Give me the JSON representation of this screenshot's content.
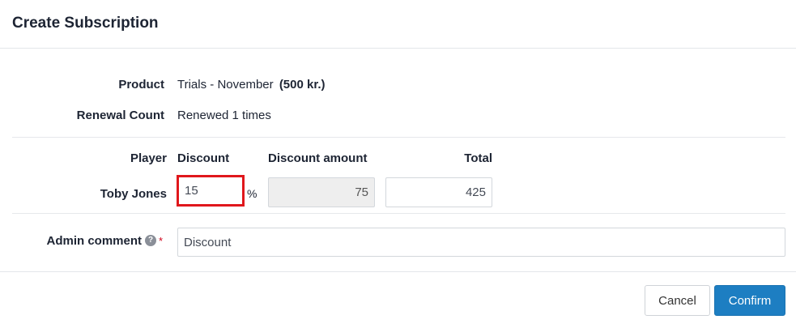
{
  "modal": {
    "title": "Create Subscription"
  },
  "details": {
    "product_label": "Product",
    "product_name": "Trials - November",
    "product_price": "(500 kr.)",
    "renewal_label": "Renewal Count",
    "renewal_value": "Renewed 1 times"
  },
  "table": {
    "headers": {
      "player": "Player",
      "discount": "Discount",
      "discount_amount": "Discount amount",
      "total": "Total"
    },
    "row": {
      "player": "Toby Jones",
      "discount_value": "15",
      "discount_unit": "%",
      "discount_amount": "75",
      "total": "425"
    }
  },
  "comment": {
    "label": "Admin comment",
    "value": "Discount",
    "help_icon": "question-circle-icon",
    "required_mark": "*"
  },
  "buttons": {
    "cancel": "Cancel",
    "confirm": "Confirm"
  },
  "colors": {
    "primary": "#1d7ec2",
    "highlight": "#e0171c",
    "required": "#d0021b"
  }
}
